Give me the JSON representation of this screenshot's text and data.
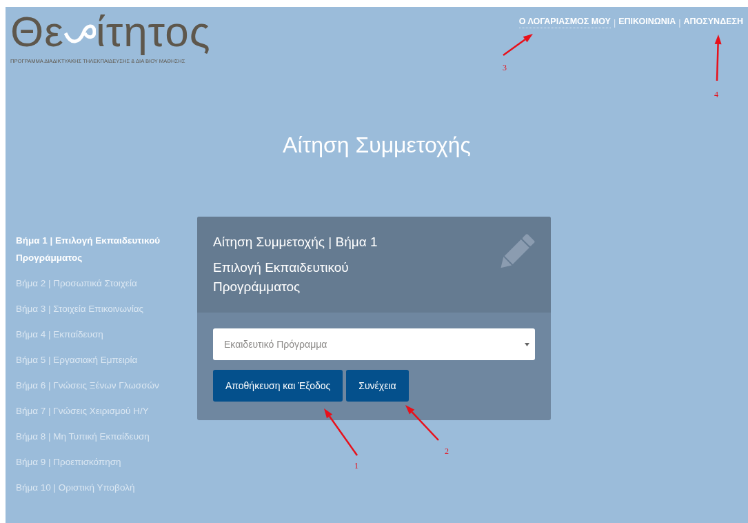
{
  "logo": {
    "before": "Θε",
    "after": "ίτητος",
    "tagline": "ΠΡΟΓΡΑΜΜΑ ΔΙΑΔΙΚΤΥΑΚΗΣ ΤΗΛΕΚΠΑΙΔΕΥΣΗΣ & ΔΙΑ ΒΙΟΥ ΜΑΘΗΣΗΣ"
  },
  "nav": {
    "items": [
      {
        "label": "Ο ΛΟΓΑΡΙΑΣΜΟΣ ΜΟΥ",
        "underlined": true
      },
      {
        "label": "ΕΠΙΚΟΙΝΩΝΙΑ",
        "underlined": false
      },
      {
        "label": "ΑΠΟΣΥΝΔΕΣΗ",
        "underlined": false
      }
    ],
    "separators": [
      "|",
      "|"
    ]
  },
  "page_title": "Αίτηση Συμμετοχής",
  "steps": [
    {
      "label": "Βήμα 1 | Επιλογή Εκπαιδευτικού Προγράμματος",
      "selected": true
    },
    {
      "label": "Βήμα 2 | Προσωπικά Στοιχεία",
      "selected": false
    },
    {
      "label": "Βήμα 3 | Στοιχεία Επικοινωνίας",
      "selected": false
    },
    {
      "label": "Βήμα 4 | Εκπαίδευση",
      "selected": false
    },
    {
      "label": "Βήμα 5 | Εργασιακή Εμπειρία",
      "selected": false
    },
    {
      "label": "Βήμα 6 | Γνώσεις Ξένων Γλωσσών",
      "selected": false
    },
    {
      "label": "Βήμα 7 | Γνώσεις Χειρισμού Η/Υ",
      "selected": false
    },
    {
      "label": "Βήμα 8 | Μη Τυπική Εκπαίδευση",
      "selected": false
    },
    {
      "label": "Βήμα 9 | Προεπισκόπηση",
      "selected": false
    },
    {
      "label": "Βήμα 10 | Οριστική Υποβολή",
      "selected": false
    }
  ],
  "card": {
    "title": "Αίτηση Συμμετοχής | Βήμα 1",
    "subtitle": "Επιλογή Εκπαιδευτικού Προγράμματος",
    "select": {
      "placeholder": "Εκαιδευτικό Πρόγραμμα"
    },
    "buttons": [
      "Αποθήκευση και Έξοδος",
      "Συνέχεια"
    ]
  },
  "annotations": [
    {
      "label": "1"
    },
    {
      "label": "2"
    },
    {
      "label": "3"
    },
    {
      "label": "4"
    }
  ]
}
